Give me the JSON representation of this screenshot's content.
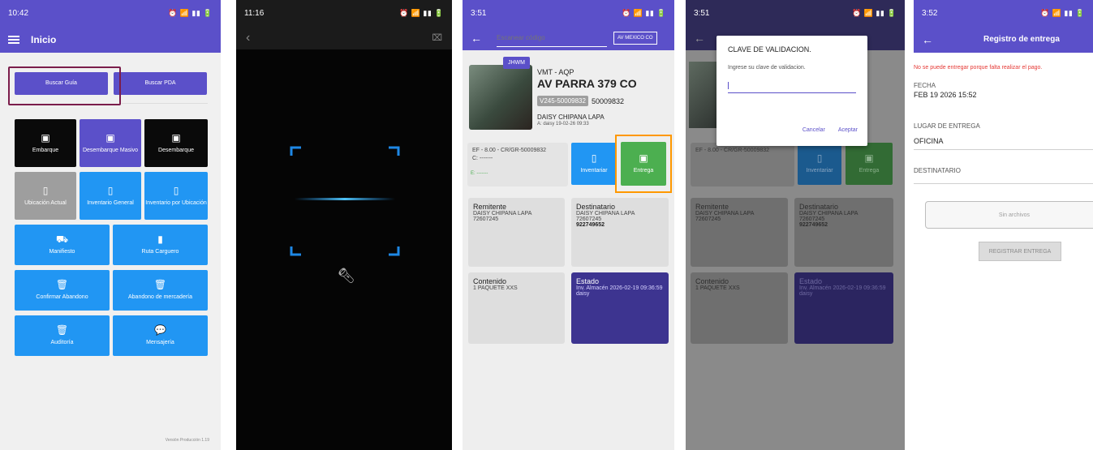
{
  "s1": {
    "time": "10:42",
    "status_right": "⏰ 📶 ▮▮ 🔋",
    "title": "Inicio",
    "buscar_guia": "Buscar Guía",
    "buscar_pda": "Buscar PDA",
    "tiles": {
      "embarque": "Embarque",
      "desembarque_masivo": "Desembarque Masivo",
      "desembarque": "Desembarque",
      "ubicacion_actual": "Ubicación Actual",
      "inventario_general": "Inventario General",
      "inventario_por_ubicacion": "Inventario por Ubicación",
      "manifiesto": "Manifiesto",
      "ruta_carguero": "Ruta Carguero",
      "confirmar_abandono": "Confirmar Abandono",
      "abandono_mercaderia": "Abandono de mercadería",
      "auditoria": "Auditoría",
      "mensajeria": "Mensajería"
    },
    "version": "Versión Producción 1.19"
  },
  "s2": {
    "time": "11:16"
  },
  "s3": {
    "time": "3:51",
    "search_placeholder": "Escanear código",
    "location_chip": "AV MEXICO CO",
    "badge": "JHWM",
    "route": "VMT - AQP",
    "address": "AV PARRA 379 CO",
    "guide_code": "V245-50009832",
    "guide_number": "50009832",
    "person": "DAISY CHIPANA LAPA",
    "meta": "A: daisy 19-02-26 09:33",
    "ef_line": "EF - 8.00 - CR/GR-50009832",
    "c_line": "C: -------",
    "e_line": "E: -------",
    "btn_inventariar": "Inventariar",
    "btn_entrega": "Entrega",
    "remitente_title": "Remitente",
    "remitente_name": "DAISY CHIPANA LAPA",
    "remitente_doc": "72607245",
    "destinatario_title": "Destinatario",
    "destinatario_name": "DAISY CHIPANA LAPA",
    "destinatario_doc": "72607245",
    "destinatario_phone": "922749652",
    "contenido_title": "Contenido",
    "contenido_value": "1 PAQUETE XXS",
    "estado_title": "Estado",
    "estado_value": "Inv. Almacén 2026-02-19 09:36:59 daisy"
  },
  "s4": {
    "time": "3:51",
    "dialog_title": "CLAVE DE VALIDACION.",
    "dialog_prompt": "Ingrese su clave de validacion.",
    "cancel": "Cancelar",
    "accept": "Aceptar"
  },
  "s5": {
    "time": "3:52",
    "title": "Registro de entrega",
    "error": "No se puede entregar porque falta realizar el pago.",
    "fecha_label": "FECHA",
    "fecha_value": "FEB 19 2026 15:52",
    "lugar_label": "LUGAR DE ENTREGA",
    "lugar_value": "OFICINA",
    "destinatario_label": "DESTINATARIO",
    "sin_archivos": "Sin archivos",
    "registrar": "REGISTRAR ENTREGA"
  },
  "colors": {
    "primary": "#5b50c9",
    "blue": "#2196f3",
    "green": "#4caf50",
    "highlight_orange": "#ff9800",
    "highlight_maroon": "#7b1d4b",
    "error_red": "#e53935"
  }
}
